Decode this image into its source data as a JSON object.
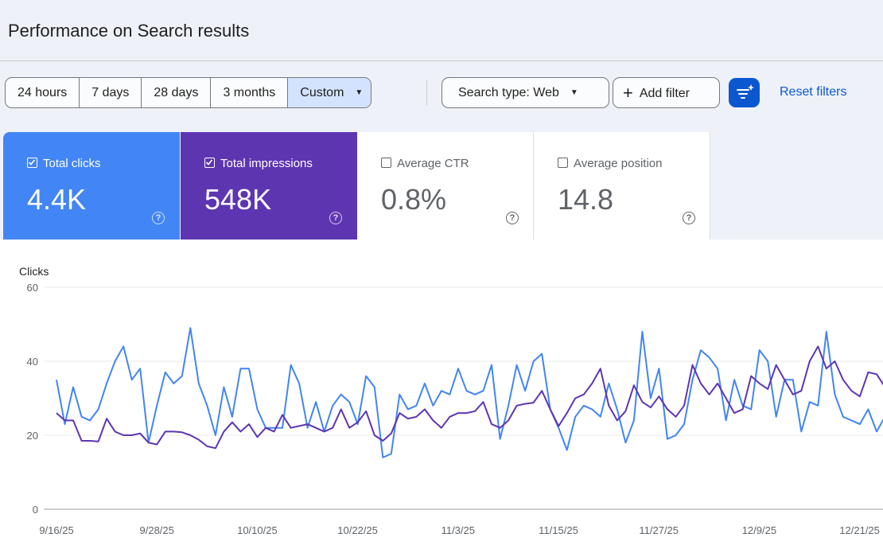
{
  "header": {
    "title": "Performance on Search results"
  },
  "toolbar": {
    "ranges": [
      "24 hours",
      "7 days",
      "28 days",
      "3 months",
      "Custom"
    ],
    "search_type": "Search type: Web",
    "add_filter": "Add filter",
    "reset_filters": "Reset filters"
  },
  "metrics": [
    {
      "label": "Total clicks",
      "value": "4.4K",
      "checked": true,
      "color": "#4285f4"
    },
    {
      "label": "Total impressions",
      "value": "548K",
      "checked": true,
      "color": "#5e35b1"
    },
    {
      "label": "Average CTR",
      "value": "0.8%",
      "checked": false
    },
    {
      "label": "Average position",
      "value": "14.8",
      "checked": false
    }
  ],
  "chart_data": {
    "type": "line",
    "ylabel": "Clicks",
    "ylim": [
      0,
      60
    ],
    "yticks": [
      "60",
      "40",
      "20",
      "0"
    ],
    "x_tick_labels": [
      "9/16/25",
      "9/28/25",
      "10/10/25",
      "10/22/25",
      "11/3/25",
      "11/15/25",
      "11/27/25",
      "12/9/25",
      "12/21/25"
    ],
    "series": [
      {
        "name": "Clicks",
        "color": "#4285f4",
        "values": [
          35,
          23,
          33,
          25,
          24,
          27,
          34,
          40,
          44,
          35,
          38,
          18,
          28,
          37,
          34,
          36,
          49,
          34,
          28,
          20,
          33,
          25,
          38,
          38,
          27,
          22,
          22,
          22,
          39,
          34,
          22,
          29,
          21,
          28,
          31,
          29,
          23,
          36,
          33,
          14,
          15,
          31,
          27,
          28,
          34,
          28,
          32,
          31,
          38,
          32,
          31,
          32,
          39,
          19,
          28,
          39,
          32,
          40,
          42,
          27,
          22,
          16,
          25,
          28,
          27,
          25,
          34,
          27,
          18,
          24,
          48,
          30,
          38,
          19,
          20,
          23,
          35,
          43,
          41,
          38,
          24,
          35,
          28,
          27,
          43,
          40,
          25,
          35,
          35,
          21,
          29,
          28,
          48,
          31,
          25,
          24,
          23,
          27,
          21,
          25
        ]
      },
      {
        "name": "Impressions",
        "color": "#5e35b1",
        "values": [
          26,
          24,
          24,
          18.5,
          18.5,
          18.3,
          24.5,
          21,
          20,
          20,
          20.5,
          18,
          17.5,
          21,
          21,
          20.8,
          20,
          18.8,
          17,
          16.5,
          21,
          23.5,
          21,
          23,
          19.5,
          22,
          21,
          25.5,
          22,
          22.5,
          23,
          22,
          21,
          22,
          27,
          22,
          23.5,
          26.5,
          20,
          18.5,
          20.5,
          26,
          24.5,
          25,
          27,
          24,
          22,
          25,
          26,
          26,
          26.5,
          29,
          23,
          22,
          24,
          28,
          28.5,
          28.8,
          32,
          27,
          22.5,
          26,
          30,
          31,
          34,
          38,
          28,
          24,
          26.5,
          33.5,
          29,
          27.5,
          30.5,
          27,
          25,
          28,
          39,
          34,
          31,
          34,
          30,
          26,
          27,
          36,
          34,
          32.5,
          39,
          35,
          31,
          32,
          40,
          44,
          38,
          40,
          35,
          32,
          30.5,
          37,
          36.5,
          33
        ]
      }
    ]
  }
}
